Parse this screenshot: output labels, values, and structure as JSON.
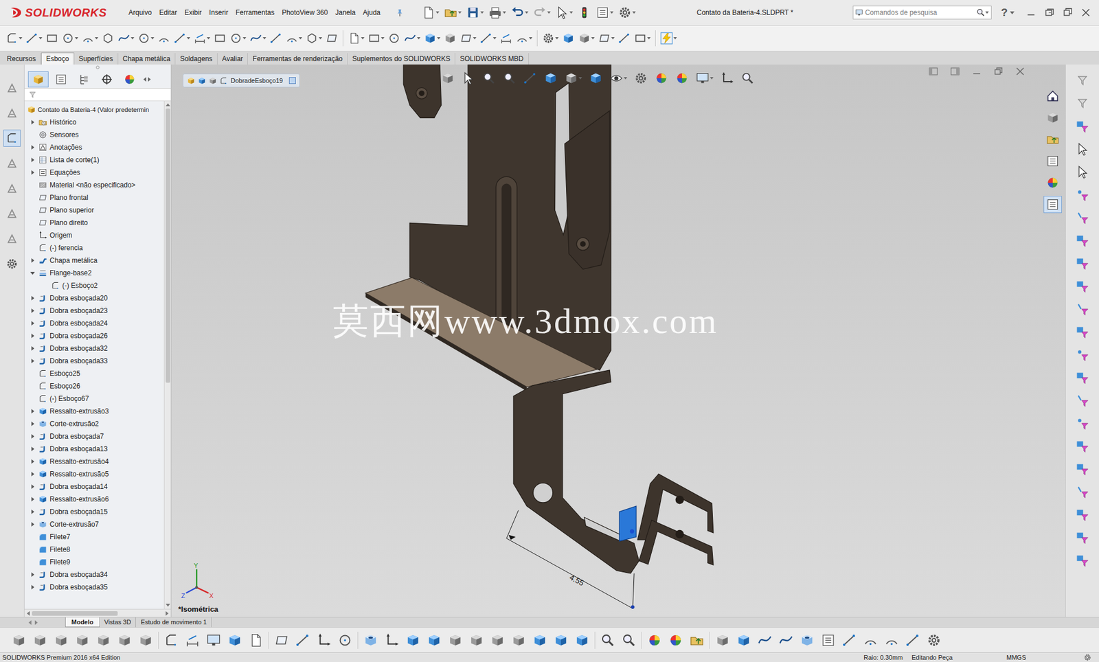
{
  "window": {
    "title": "Contato da Bateria-4.SLDPRT *"
  },
  "app": {
    "name": "SOLIDWORKS"
  },
  "menu": [
    "Arquivo",
    "Editar",
    "Exibir",
    "Inserir",
    "Ferramentas",
    "PhotoView 360",
    "Janela",
    "Ajuda"
  ],
  "search": {
    "placeholder": "Comandos de pesquisa"
  },
  "help": "?",
  "command_tabs": [
    {
      "label": "Recursos",
      "selected": false
    },
    {
      "label": "Esboço",
      "selected": true
    },
    {
      "label": "Superfícies",
      "selected": false
    },
    {
      "label": "Chapa metálica",
      "selected": false
    },
    {
      "label": "Soldagens",
      "selected": false
    },
    {
      "label": "Avaliar",
      "selected": false
    },
    {
      "label": "Ferramentas de renderização",
      "selected": false
    },
    {
      "label": "Suplementos do SOLIDWORKS",
      "selected": false
    },
    {
      "label": "SOLIDWORKS MBD",
      "selected": false
    }
  ],
  "tree": {
    "root": "Contato da Bateria-4  (Valor predetermin",
    "items": [
      {
        "label": "Histórico",
        "kind": "history",
        "expandable": true,
        "expanded": false
      },
      {
        "label": "Sensores",
        "kind": "sensor",
        "expandable": false,
        "expanded": false
      },
      {
        "label": "Anotações",
        "kind": "annotation",
        "expandable": true,
        "expanded": false
      },
      {
        "label": "Lista de corte(1)",
        "kind": "cutlist",
        "expandable": true,
        "expanded": false
      },
      {
        "label": "Equações",
        "kind": "equation",
        "expandable": true,
        "expanded": false
      },
      {
        "label": "Material <não especificado>",
        "kind": "material",
        "expandable": false,
        "expanded": false
      },
      {
        "label": "Plano frontal",
        "kind": "plane",
        "expandable": false,
        "expanded": false
      },
      {
        "label": "Plano superior",
        "kind": "plane",
        "expandable": false,
        "expanded": false
      },
      {
        "label": "Plano direito",
        "kind": "plane",
        "expandable": false,
        "expanded": false
      },
      {
        "label": "Origem",
        "kind": "origin",
        "expandable": false,
        "expanded": false
      },
      {
        "label": "(-) ferencia",
        "kind": "sketch",
        "expandable": false,
        "expanded": false
      },
      {
        "label": "Chapa metálica",
        "kind": "sheetmetal",
        "expandable": true,
        "expanded": false
      },
      {
        "label": "Flange-base2",
        "kind": "flange",
        "expandable": true,
        "expanded": true,
        "children": [
          {
            "label": "(-) Esboço2",
            "kind": "sketch",
            "expandable": false,
            "expanded": false
          }
        ]
      },
      {
        "label": "Dobra esboçada20",
        "kind": "bend",
        "expandable": true,
        "expanded": false
      },
      {
        "label": "Dobra esboçada23",
        "kind": "bend",
        "expandable": true,
        "expanded": false
      },
      {
        "label": "Dobra esboçada24",
        "kind": "bend",
        "expandable": true,
        "expanded": false
      },
      {
        "label": "Dobra esboçada26",
        "kind": "bend",
        "expandable": true,
        "expanded": false
      },
      {
        "label": "Dobra esboçada32",
        "kind": "bend",
        "expandable": true,
        "expanded": false
      },
      {
        "label": "Dobra esboçada33",
        "kind": "bend",
        "expandable": true,
        "expanded": false
      },
      {
        "label": "Esboço25",
        "kind": "sketch",
        "expandable": false,
        "expanded": false
      },
      {
        "label": "Esboço26",
        "kind": "sketch",
        "expandable": false,
        "expanded": false
      },
      {
        "label": "(-) Esboço67",
        "kind": "sketch",
        "expandable": false,
        "expanded": false
      },
      {
        "label": "Ressalto-extrusão3",
        "kind": "extrude",
        "expandable": true,
        "expanded": false
      },
      {
        "label": "Corte-extrusão2",
        "kind": "cut",
        "expandable": true,
        "expanded": false
      },
      {
        "label": "Dobra esboçada7",
        "kind": "bend",
        "expandable": true,
        "expanded": false
      },
      {
        "label": "Dobra esboçada13",
        "kind": "bend",
        "expandable": true,
        "expanded": false
      },
      {
        "label": "Ressalto-extrusão4",
        "kind": "extrude",
        "expandable": true,
        "expanded": false
      },
      {
        "label": "Ressalto-extrusão5",
        "kind": "extrude",
        "expandable": true,
        "expanded": false
      },
      {
        "label": "Dobra esboçada14",
        "kind": "bend",
        "expandable": true,
        "expanded": false
      },
      {
        "label": "Ressalto-extrusão6",
        "kind": "extrude",
        "expandable": true,
        "expanded": false
      },
      {
        "label": "Dobra esboçada15",
        "kind": "bend",
        "expandable": true,
        "expanded": false
      },
      {
        "label": "Corte-extrusão7",
        "kind": "cut",
        "expandable": true,
        "expanded": false
      },
      {
        "label": "Filete7",
        "kind": "fillet",
        "expandable": false,
        "expanded": false
      },
      {
        "label": "Filete8",
        "kind": "fillet",
        "expandable": false,
        "expanded": false
      },
      {
        "label": "Filete9",
        "kind": "fillet",
        "expandable": false,
        "expanded": false
      },
      {
        "label": "Dobra esboçada34",
        "kind": "bend",
        "expandable": true,
        "expanded": false
      },
      {
        "label": "Dobra esboçada35",
        "kind": "bend",
        "expandable": true,
        "expanded": false
      }
    ]
  },
  "viewport": {
    "breadcrumb": "DobradeEsboço19",
    "view_name": "*Isométrica",
    "watermark": "莫西网www.3dmox.com",
    "dimension": "4.55",
    "axes": {
      "x": "X",
      "y": "Y",
      "z": "Z"
    }
  },
  "bottom_tabs": [
    {
      "label": "Modelo",
      "selected": true
    },
    {
      "label": "Vistas 3D",
      "selected": false
    },
    {
      "label": "Estudo de movimento 1",
      "selected": false
    }
  ],
  "status_bar": {
    "edition": "SOLIDWORKS Premium 2016 x64 Edition",
    "radius": "Raio: 0.30mm",
    "mode": "Editando Peça",
    "units": "MMGS"
  }
}
